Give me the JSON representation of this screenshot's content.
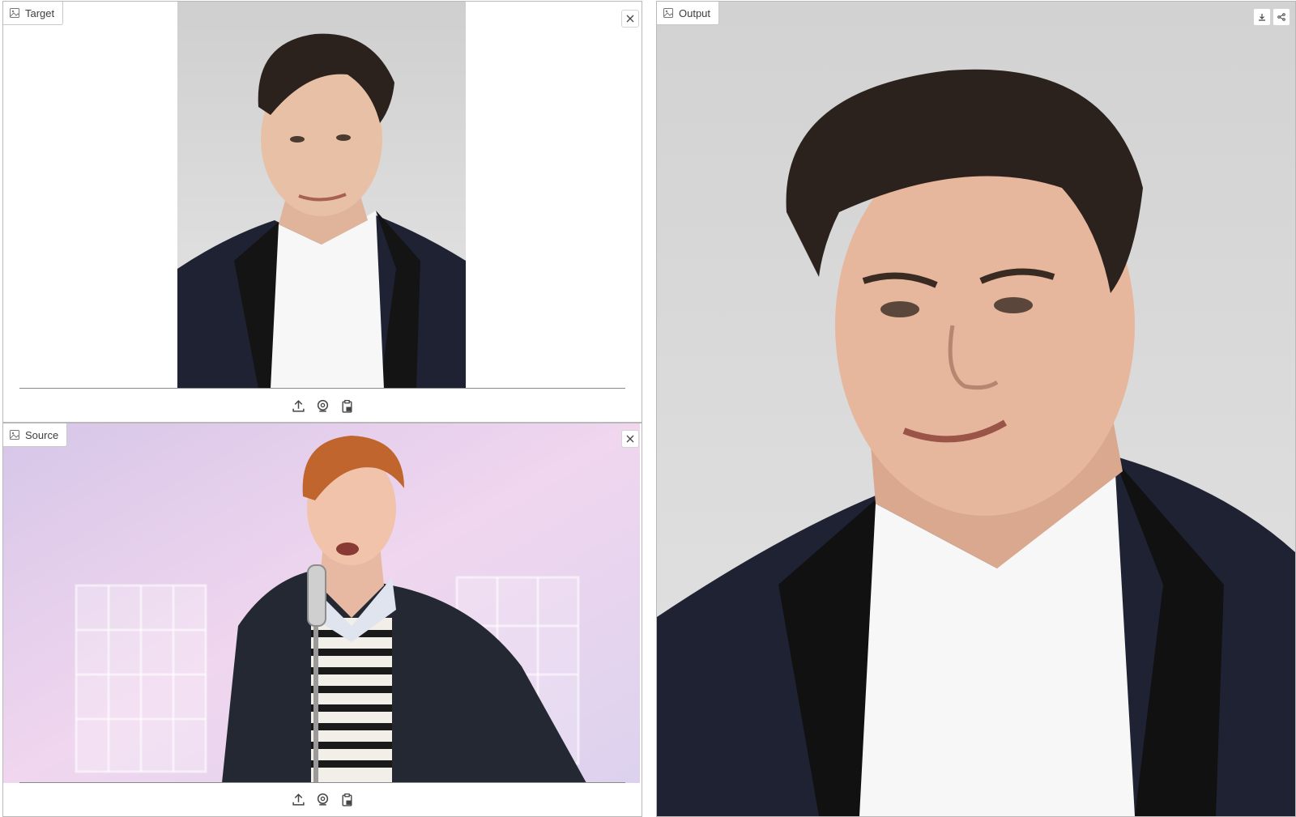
{
  "target": {
    "label": "Target",
    "image_icon": "image-icon",
    "close_icon": "close-icon"
  },
  "source": {
    "label": "Source",
    "image_icon": "image-icon",
    "close_icon": "close-icon"
  },
  "output": {
    "label": "Output",
    "image_icon": "image-icon",
    "download_icon": "download-icon",
    "share_icon": "share-icon"
  },
  "toolbar_icons": [
    "upload-icon",
    "webcam-icon",
    "clipboard-icon"
  ],
  "colors": {
    "panel_border": "#b9b9b9",
    "studio_backdrop": "#d9d9d9",
    "suit": "#1f2233",
    "shirt": "#f7f7f7",
    "hair_dark": "#2b221d",
    "hair_ginger": "#c0652e",
    "video_haze": "#e7cdea"
  }
}
